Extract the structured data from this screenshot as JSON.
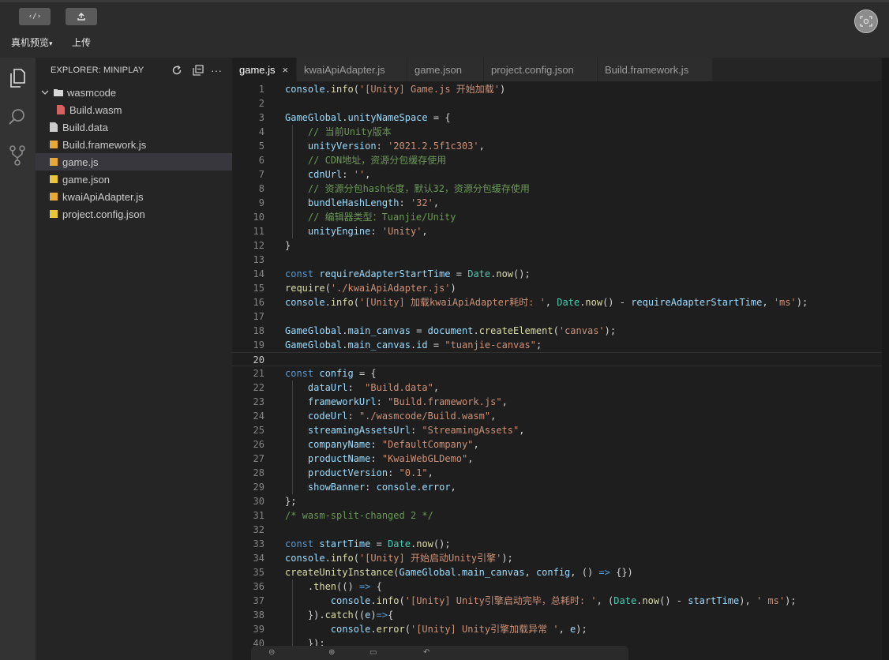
{
  "toolbar": {
    "preview_label": "真机预览",
    "upload_label": "上传",
    "code_icon": "code-icon",
    "upload_icon": "upload-icon",
    "scan_icon": "scan-icon"
  },
  "activity": [
    "files-icon",
    "search-icon",
    "source-control-icon"
  ],
  "explorer": {
    "title": "EXPLORER: MINIPLAY",
    "items": [
      {
        "label": "wasmcode",
        "kind": "folder"
      },
      {
        "label": "Build.wasm",
        "kind": "wasm"
      },
      {
        "label": "Build.data",
        "kind": "file"
      },
      {
        "label": "Build.framework.js",
        "kind": "js"
      },
      {
        "label": "game.js",
        "kind": "js"
      },
      {
        "label": "game.json",
        "kind": "json"
      },
      {
        "label": "kwaiApiAdapter.js",
        "kind": "js"
      },
      {
        "label": "project.config.json",
        "kind": "json"
      }
    ]
  },
  "tabs": [
    {
      "label": "game.js",
      "active": true
    },
    {
      "label": "kwaiApiAdapter.js"
    },
    {
      "label": "game.json"
    },
    {
      "label": "project.config.json"
    },
    {
      "label": "Build.framework.js"
    }
  ],
  "editor": {
    "current_line": 20,
    "lines": [
      "console.info('[Unity] Game.js 开始加载')",
      "",
      "GameGlobal.unityNameSpace = {",
      "    // 当前Unity版本",
      "    unityVersion: '2021.2.5f1c303',",
      "    // CDN地址，资源分包缓存使用",
      "    cdnUrl: '',",
      "    // 资源分包hash长度，默认32，资源分包缓存使用",
      "    bundleHashLength: '32',",
      "    // 编辑器类型：Tuanjie/Unity",
      "    unityEngine: 'Unity',",
      "}",
      "",
      "const requireAdapterStartTime = Date.now();",
      "require('./kwaiApiAdapter.js')",
      "console.info('[Unity] 加载kwaiApiAdapter耗时: ', Date.now() - requireAdapterStartTime, 'ms');",
      "",
      "GameGlobal.main_canvas = document.createElement('canvas');",
      "GameGlobal.main_canvas.id = \"tuanjie-canvas\";",
      "",
      "const config = {",
      "    dataUrl:  \"Build.data\",",
      "    frameworkUrl: \"Build.framework.js\",",
      "    codeUrl: \"./wasmcode/Build.wasm\",",
      "    streamingAssetsUrl: \"StreamingAssets\",",
      "    companyName: \"DefaultCompany\",",
      "    productName: \"KwaiWebGLDemo\",",
      "    productVersion: \"0.1\",",
      "    showBanner: console.error,",
      "};",
      "/* wasm-split-changed 2 */",
      "",
      "const startTime = Date.now();",
      "console.info('[Unity] 开始启动Unity引擎');",
      "createUnityInstance(GameGlobal.main_canvas, config, () => {})",
      "    .then(() => {",
      "        console.info('[Unity] Unity引擎启动完毕，总耗时: ', (Date.now() - startTime), ' ms');",
      "    }).catch((e)=>{",
      "        console.error('[Unity] Unity引擎加载异常 ', e);",
      "    });"
    ]
  }
}
